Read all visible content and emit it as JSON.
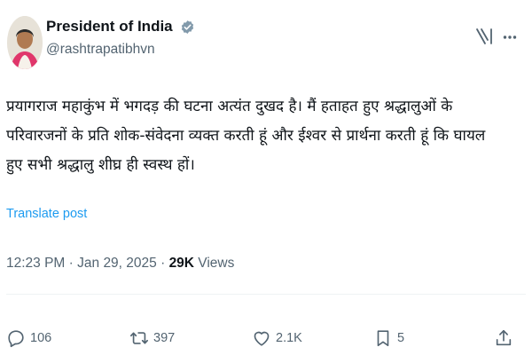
{
  "author": {
    "display_name": "President of India",
    "handle": "@rashtrapatibhvn"
  },
  "icons": {
    "verified": "verified-badge-icon",
    "grok": "grok-icon",
    "more": "more-options-icon",
    "reply": "reply-icon",
    "retweet": "retweet-icon",
    "like": "like-icon",
    "bookmark": "bookmark-icon",
    "share": "share-icon"
  },
  "tweet": {
    "lines": [
      "प्रयागराज महाकुंभ में भगदड़ की घटना अत्यंत दुखद है। मैं हताहत हुए श्रद्धालुओं के",
      "परिवारजनों के प्रति शोक-संवेदना व्यक्त करती हूं और ईश्वर से प्रार्थना करती हूं कि घायल",
      "हुए सभी श्रद्धालु शीघ्र ही स्वस्थ हों।"
    ],
    "translate_label": "Translate post"
  },
  "meta": {
    "time": "12:23 PM",
    "separator": " · ",
    "date": "Jan 29, 2025",
    "views_count": "29K",
    "views_label": " Views"
  },
  "actions": {
    "replies": "106",
    "reposts": "397",
    "likes": "2.1K",
    "bookmarks": "5"
  },
  "colors": {
    "text": "#0f1419",
    "secondary": "#536471",
    "link": "#1d9bf0",
    "verified": "#829aab"
  }
}
